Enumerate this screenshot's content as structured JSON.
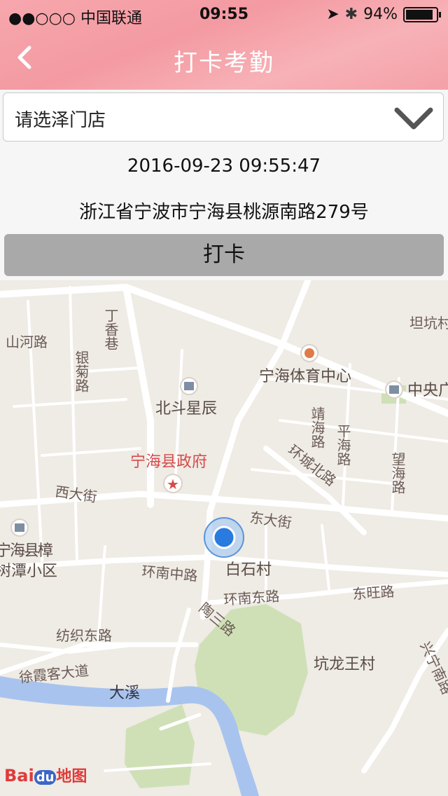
{
  "status": {
    "carrier": "●●○○○ 中国联通",
    "time": "09:55",
    "battery": "94%",
    "battery_level": 0.94
  },
  "nav": {
    "title": "打卡考勤",
    "back_icon": "chevron-left-icon"
  },
  "store_select": {
    "label": "请选泽门店",
    "icon": "chevron-down-icon"
  },
  "datetime": "2016-09-23 09:55:47",
  "address": "浙江省宁波市宁海县桃源南路279号",
  "punch_button": "打卡",
  "map": {
    "labels": {
      "shanhe": "山河路",
      "yinju": "银菊路",
      "dingxiang": "丁香巷",
      "beidou": "北斗星辰",
      "tiyu": "宁海体育中心",
      "zhongyang": "中央广",
      "tankeng": "坦坑村",
      "jinghai": "靖海路",
      "pinghai": "平海路",
      "wanghai": "望海路",
      "huancheng": "环城北路",
      "zhengfu": "宁海县政府",
      "xidajie": "西大街",
      "dongdajie": "东大街",
      "zhangshu": "宁海县樟树潭小区",
      "huannanzhong": "环南中路",
      "baishi": "白石村",
      "huannandong": "环南东路",
      "dongwang": "东旺路",
      "taosan": "陶三路",
      "fangzhi": "纺织东路",
      "xuxiake": "徐霞客大道",
      "daxi": "大溪",
      "kenglongwang": "坑龙王村",
      "xingning": "兴宁南路"
    },
    "logo": {
      "bai": "Bai",
      "du": "du",
      "map": "地图"
    }
  },
  "colors": {
    "header": "#f6a7ad",
    "punch_button": "#a9a9a9",
    "river": "#a8c4ee",
    "park": "#cfe0b7",
    "location": "#2a7be0"
  }
}
